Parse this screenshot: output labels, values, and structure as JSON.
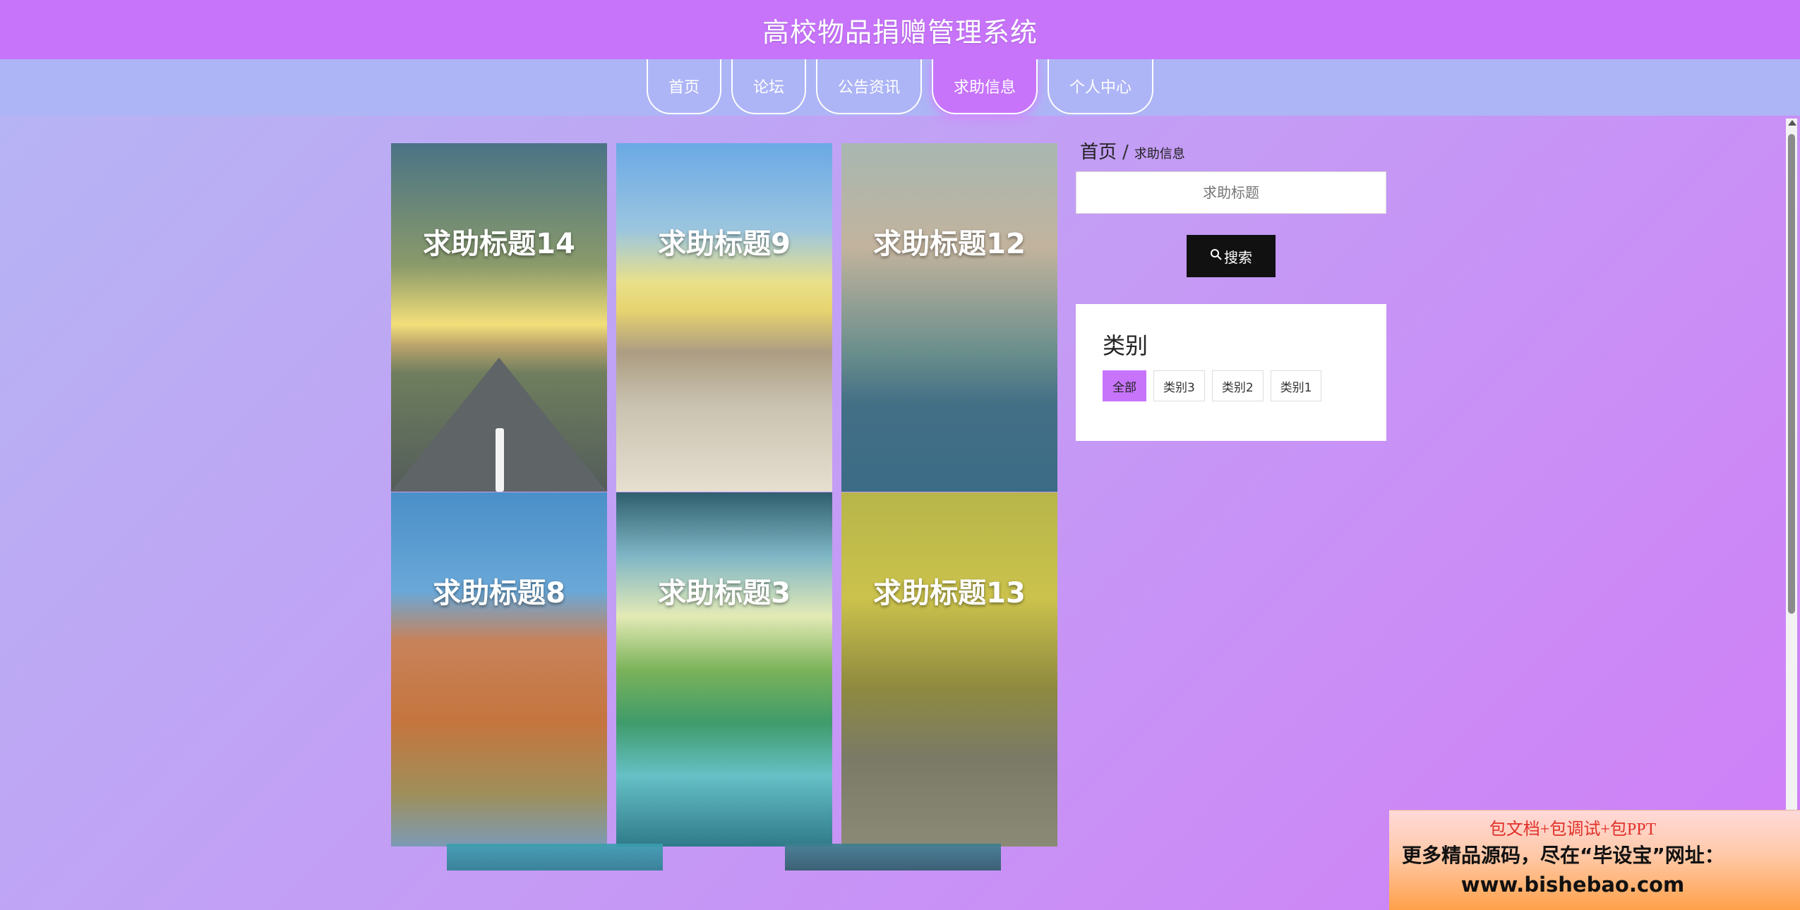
{
  "header": {
    "title": "高校物品捐赠管理系统"
  },
  "nav": {
    "items": [
      {
        "label": "首页"
      },
      {
        "label": "论坛"
      },
      {
        "label": "公告资讯"
      },
      {
        "label": "求助信息",
        "active": true
      },
      {
        "label": "个人中心"
      }
    ]
  },
  "cards": [
    {
      "title": "求助标题14"
    },
    {
      "title": "求助标题9"
    },
    {
      "title": "求助标题12"
    },
    {
      "title": "求助标题8"
    },
    {
      "title": "求助标题3"
    },
    {
      "title": "求助标题13"
    }
  ],
  "breadcrumb": {
    "home": "首页",
    "separator": "/",
    "current": "求助信息"
  },
  "search": {
    "placeholder": "求助标题",
    "button_label": "搜索",
    "icon": "search-icon"
  },
  "categories": {
    "title": "类别",
    "items": [
      {
        "label": "全部",
        "active": true
      },
      {
        "label": "类别3"
      },
      {
        "label": "类别2"
      },
      {
        "label": "类别1"
      }
    ]
  },
  "promo": {
    "line1": "包文档+包调试+包PPT",
    "line2": "更多精品源码，尽在“毕设宝”网址：",
    "line3": "www.bishebao.com"
  },
  "colors": {
    "accent": "#c774fa",
    "nav_band": "#adb5f6",
    "search_button": "#111111"
  }
}
